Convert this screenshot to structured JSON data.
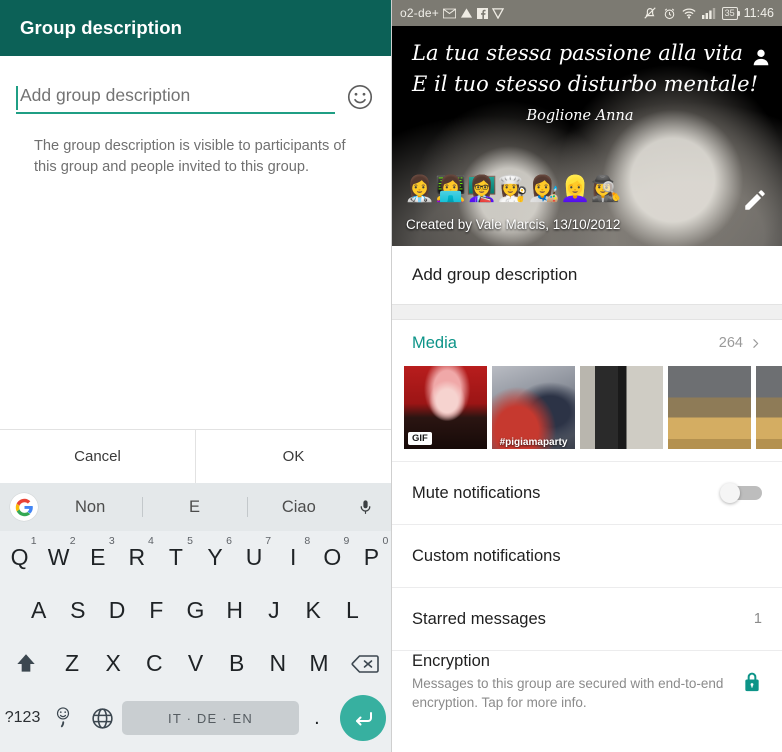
{
  "left": {
    "app_bar": {
      "title": "Group description"
    },
    "description_field": {
      "value": "",
      "placeholder": "Add group description",
      "emoji_icon": "smiley-face-icon"
    },
    "helper_text": "The group description is visible to participants of this group and people invited to this group.",
    "actions": {
      "cancel": "Cancel",
      "ok": "OK"
    },
    "keyboard": {
      "google_icon": "google-g-icon",
      "mic_icon": "microphone-icon",
      "suggestions": [
        "Non",
        "E",
        "Ciao"
      ],
      "row1": [
        {
          "letter": "Q",
          "num": "1"
        },
        {
          "letter": "W",
          "num": "2"
        },
        {
          "letter": "E",
          "num": "3"
        },
        {
          "letter": "R",
          "num": "4"
        },
        {
          "letter": "T",
          "num": "5"
        },
        {
          "letter": "Y",
          "num": "6"
        },
        {
          "letter": "U",
          "num": "7"
        },
        {
          "letter": "I",
          "num": "8"
        },
        {
          "letter": "O",
          "num": "9"
        },
        {
          "letter": "P",
          "num": "0"
        }
      ],
      "row2": [
        "A",
        "S",
        "D",
        "F",
        "G",
        "H",
        "J",
        "K",
        "L"
      ],
      "row3_letters": [
        "Z",
        "X",
        "C",
        "V",
        "B",
        "N",
        "M"
      ],
      "shift_icon": "shift-arrow-icon",
      "backspace_icon": "backspace-icon",
      "symbols_key": "?123",
      "comma_key": ",",
      "emoji_comma_icon": "emoji-smiley-icon",
      "globe_icon": "globe-language-icon",
      "space_key": "IT · DE · EN",
      "period_key": ".",
      "enter_icon": "enter-return-icon"
    },
    "colors": {
      "app_bar": "#0c6157",
      "accent": "#1f9e84",
      "enter_key": "#37b0a0"
    }
  },
  "right": {
    "status_bar": {
      "carrier": "o2-de+",
      "icons_left": [
        "gmail-icon",
        "drive-icon",
        "facebook-icon",
        "app-icon"
      ],
      "icons_right": [
        "mute-bell-icon",
        "alarm-clock-icon",
        "wifi-icon",
        "signal-bars-icon"
      ],
      "battery": "35",
      "time": "11:46"
    },
    "hero": {
      "quote_line1": "La tua stessa passione alla vita",
      "quote_line2": "E il tuo stesso disturbo mentale!",
      "author": "Boglione Anna",
      "emojis": [
        "👩‍⚕️",
        "👩‍💻",
        "👩‍🏫",
        "👩‍🍳",
        "👩‍🎨",
        "👱‍♀️",
        "🕵️‍♀️"
      ],
      "created_by": "Created by Vale Marcis, 13/10/2012",
      "person_icon": "person-icon",
      "edit_icon": "edit-pencil-icon"
    },
    "add_description": "Add group description",
    "media": {
      "title": "Media",
      "count": "264",
      "chevron_icon": "chevron-right-icon",
      "thumbnails": [
        {
          "class": "t1",
          "badge": "GIF",
          "caption": ""
        },
        {
          "class": "t2",
          "badge": "",
          "caption": "#pigiamaparty"
        },
        {
          "class": "t3",
          "badge": "",
          "caption": ""
        },
        {
          "class": "t4",
          "badge": "",
          "caption": ""
        },
        {
          "class": "t5",
          "badge": "",
          "caption": ""
        }
      ]
    },
    "rows": {
      "mute": {
        "title": "Mute notifications",
        "toggle_state": "off"
      },
      "custom": {
        "title": "Custom notifications"
      },
      "starred": {
        "title": "Starred messages",
        "value": "1"
      },
      "encryption": {
        "title": "Encryption",
        "subtitle": "Messages to this group are secured with end-to-end encryption. Tap for more info.",
        "lock_icon": "lock-icon"
      }
    },
    "colors": {
      "accent": "#0d9488",
      "status_bar": "#7c7a72"
    }
  }
}
